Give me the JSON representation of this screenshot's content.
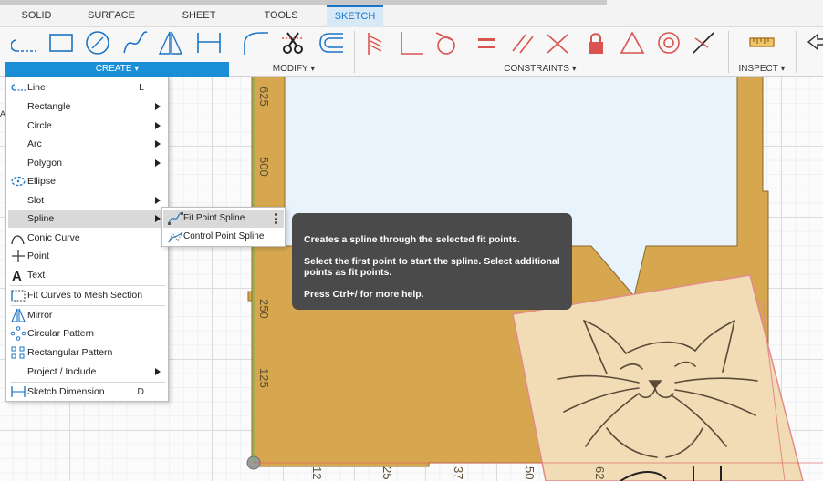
{
  "tabs": [
    {
      "label": "SOLID",
      "active": false
    },
    {
      "label": "SURFACE",
      "active": false
    },
    {
      "label": "SHEET METAL",
      "active": false
    },
    {
      "label": "TOOLS",
      "active": false
    },
    {
      "label": "SKETCH",
      "active": true
    }
  ],
  "ribbon_groups": {
    "create": "CREATE ▾",
    "modify": "MODIFY ▾",
    "constraints": "CONSTRAINTS ▾",
    "inspect": "INSPECT ▾"
  },
  "ribbon_tools": {
    "create": [
      "line-tool-icon",
      "rectangle-tool-icon",
      "circle-tool-icon",
      "spline-tool-icon",
      "mirror-tool-icon",
      "dimension-tool-icon"
    ],
    "modify": [
      "fillet-tool-icon",
      "trim-tool-icon",
      "offset-tool-icon"
    ],
    "constraints": [
      "coincident-icon",
      "perpendicular-icon",
      "tangent-icon",
      "equal-icon",
      "parallel-icon",
      "collinear-icon",
      "fix-lock-icon",
      "midpoint-icon",
      "concentric-icon",
      "symmetry-icon"
    ],
    "inspect": [
      "measure-icon"
    ]
  },
  "create_menu": [
    {
      "label": "Line",
      "shortcut": "L",
      "submenu": false,
      "icon": "line-icon"
    },
    {
      "label": "Rectangle",
      "shortcut": "",
      "submenu": true,
      "icon": ""
    },
    {
      "label": "Circle",
      "shortcut": "",
      "submenu": true,
      "icon": ""
    },
    {
      "label": "Arc",
      "shortcut": "",
      "submenu": true,
      "icon": ""
    },
    {
      "label": "Polygon",
      "shortcut": "",
      "submenu": true,
      "icon": ""
    },
    {
      "label": "Ellipse",
      "shortcut": "",
      "submenu": false,
      "icon": "ellipse-icon"
    },
    {
      "label": "Slot",
      "shortcut": "",
      "submenu": true,
      "icon": ""
    },
    {
      "label": "Spline",
      "shortcut": "",
      "submenu": true,
      "icon": "",
      "highlighted": true
    },
    {
      "label": "Conic Curve",
      "shortcut": "",
      "submenu": false,
      "icon": "conic-curve-icon"
    },
    {
      "label": "Point",
      "shortcut": "",
      "submenu": false,
      "icon": "point-icon"
    },
    {
      "label": "Text",
      "shortcut": "",
      "submenu": false,
      "icon": "text-icon"
    },
    {
      "label": "Fit Curves to Mesh Section",
      "shortcut": "",
      "submenu": false,
      "icon": "fit-curves-icon"
    },
    {
      "label": "Mirror",
      "shortcut": "",
      "submenu": false,
      "icon": "mirror-icon"
    },
    {
      "label": "Circular Pattern",
      "shortcut": "",
      "submenu": false,
      "icon": "circular-pattern-icon"
    },
    {
      "label": "Rectangular Pattern",
      "shortcut": "",
      "submenu": false,
      "icon": "rectangular-pattern-icon"
    },
    {
      "label": "Project / Include",
      "shortcut": "",
      "submenu": true,
      "icon": ""
    },
    {
      "label": "Sketch Dimension",
      "shortcut": "D",
      "submenu": false,
      "icon": "sketch-dimension-icon"
    }
  ],
  "spline_submenu": [
    {
      "label": "Fit Point Spline",
      "icon": "fit-point-spline-icon",
      "highlighted": true
    },
    {
      "label": "Control Point Spline",
      "icon": "control-point-spline-icon",
      "highlighted": false
    }
  ],
  "tooltip": {
    "line1": "Creates a spline through the selected fit points.",
    "line2": "Select the first point to start the spline. Select additional points as fit points.",
    "line3": "Press Ctrl+/ for more help."
  },
  "axis": {
    "y_labels": [
      "625",
      "500",
      "250",
      "125"
    ],
    "x_labels": [
      "12",
      "25",
      "37",
      "50",
      "62"
    ]
  },
  "colors": {
    "accent": "#1b8ed8",
    "constraint_red": "#d9534f",
    "body_fill": "#d6a74e",
    "image_fill": "#f1dcb6",
    "tooltip_bg": "#4a4a4a"
  }
}
